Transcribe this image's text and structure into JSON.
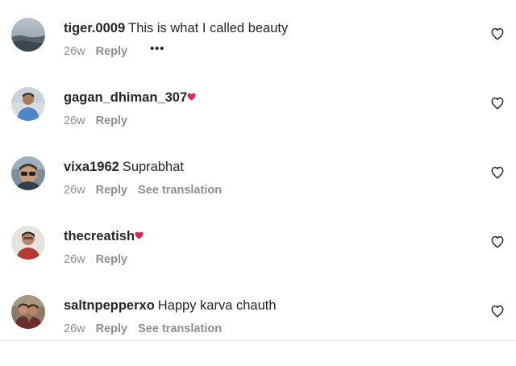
{
  "comments": [
    {
      "username": "tiger.0009",
      "text": "This is what I called beauty",
      "time": "26w",
      "reply": "Reply",
      "translation": "",
      "more": "•••",
      "emoji": false,
      "avatar": "landscape-avatar"
    },
    {
      "username": "gagan_dhiman_307",
      "text": "",
      "time": "26w",
      "reply": "Reply",
      "translation": "",
      "more": "",
      "emoji": true,
      "avatar": "man-avatar"
    },
    {
      "username": "vixa1962",
      "text": "Suprabhat",
      "time": "26w",
      "reply": "Reply",
      "translation": "See translation",
      "more": "",
      "emoji": false,
      "avatar": "sunglasses-avatar"
    },
    {
      "username": "thecreatish",
      "text": "",
      "time": "26w",
      "reply": "Reply",
      "translation": "",
      "more": "",
      "emoji": true,
      "avatar": "man-avatar"
    },
    {
      "username": "saltnpepperxo",
      "text": "Happy karva chauth",
      "time": "26w",
      "reply": "Reply",
      "translation": "See translation",
      "more": "",
      "emoji": false,
      "avatar": "couple-avatar"
    }
  ],
  "colors": {
    "text": "#262626",
    "secondary": "#8e8e8e",
    "heart_emoji": "#e0245e"
  },
  "icons": {
    "like": "heart-outline-icon",
    "emoji": "red-heart-emoji"
  }
}
